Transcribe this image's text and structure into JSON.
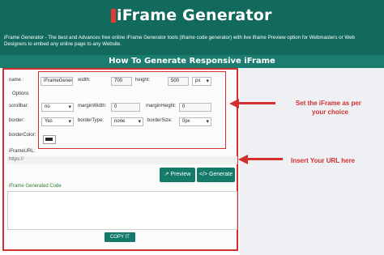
{
  "header": {
    "title": "iFrame Generator",
    "description": "iFrame Generator - The best and Advances free online iFrame Generator tools (iframe code generator) with live iframe Preview option for Webmasters or Web Designers to embed any online page to any Website."
  },
  "section_title": "How To Generate Responsive iFrame",
  "form": {
    "name_label": "name :",
    "name_value": "iFrameGenera",
    "width_label": "width:",
    "width_value": "700",
    "height_label": "height:",
    "height_value": "500",
    "unit_value": "px",
    "options_label": "Options",
    "scrollbar_label": "scrollbar:",
    "scrollbar_value": "no",
    "marginwidth_label": "marginWidth:",
    "marginwidth_value": "0",
    "marginheight_label": "marginHeight:",
    "marginheight_value": "0",
    "border_label": "border:",
    "border_value": "Yes",
    "bordertype_label": "borderType:",
    "bordertype_value": "none",
    "bordersize_label": "borderSize:",
    "bordersize_value": "0px",
    "bordercolor_label": "borderColor:",
    "iframeurl_label": "iFrameURL:",
    "iframeurl_placeholder": "https://",
    "preview_button": "Preview",
    "generate_button": "Generate",
    "generated_code_label": "iFrame Generated Code",
    "copy_button": "COPY IT"
  },
  "annotations": {
    "set_iframe_line1": "Set the iFrame as per",
    "set_iframe_line2": "your choice",
    "insert_url": "Insert Your URL here"
  },
  "colors": {
    "header_bg": "#116a5c",
    "accent_red": "#d32f2f",
    "button_green": "#147a69"
  }
}
